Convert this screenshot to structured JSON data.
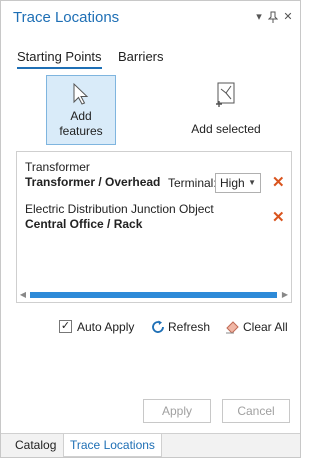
{
  "pane": {
    "title": "Trace Locations",
    "controls": {
      "menu": "▾",
      "pin": "⊥",
      "close": "✕"
    }
  },
  "tabs": [
    {
      "label": "Starting Points",
      "active": true
    },
    {
      "label": "Barriers",
      "active": false
    }
  ],
  "ribbon": {
    "add_features": {
      "line1": "Add",
      "line2": "features",
      "icon": "cursor-arrow-icon"
    },
    "add_selected": {
      "label": "Add selected",
      "icon": "select-feature-icon"
    }
  },
  "locations": [
    {
      "type": "Transformer",
      "name": "Transformer / Overhead",
      "terminal_label": "Terminal:",
      "terminal_value": "High"
    },
    {
      "type": "Electric Distribution Junction Object",
      "name": "Central Office / Rack"
    }
  ],
  "actions": {
    "auto_apply": {
      "label": "Auto Apply",
      "checked": true,
      "check_glyph": "✓"
    },
    "refresh": {
      "label": "Refresh",
      "icon": "refresh-icon"
    },
    "clear_all": {
      "label": "Clear All",
      "icon": "eraser-icon"
    }
  },
  "footer": {
    "apply": "Apply",
    "cancel": "Cancel"
  },
  "bottom_tabs": [
    {
      "label": "Catalog",
      "active": false
    },
    {
      "label": "Trace Locations",
      "active": true
    }
  ],
  "colors": {
    "accent": "#1e6fb5",
    "remove": "#d9541e",
    "selected_bg": "#d9ebf9"
  }
}
